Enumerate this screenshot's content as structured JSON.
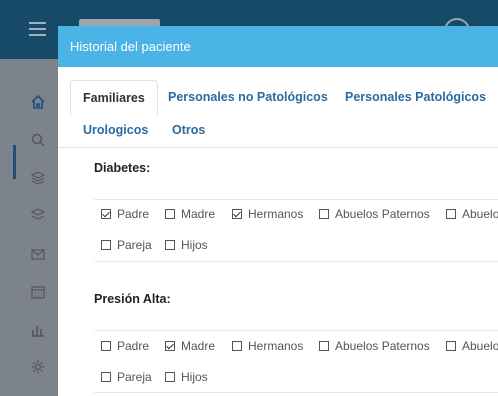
{
  "modal": {
    "title": "Historial del paciente"
  },
  "tabs": [
    {
      "label": "Familiares",
      "active": true
    },
    {
      "label": "Personales no Patológicos"
    },
    {
      "label": "Personales Patológicos"
    },
    {
      "label": "Urologicos"
    },
    {
      "label": "Otros"
    }
  ],
  "sections": [
    {
      "title": "Diabetes:",
      "options": [
        {
          "label": "Padre",
          "checked": true
        },
        {
          "label": "Madre",
          "checked": false
        },
        {
          "label": "Hermanos",
          "checked": true
        },
        {
          "label": "Abuelos Paternos",
          "checked": false
        },
        {
          "label": "Abuelo",
          "checked": false
        },
        {
          "label": "Pareja",
          "checked": false
        },
        {
          "label": "Hijos",
          "checked": false
        }
      ]
    },
    {
      "title": "Presión Alta:",
      "options": [
        {
          "label": "Padre",
          "checked": false
        },
        {
          "label": "Madre",
          "checked": true
        },
        {
          "label": "Hermanos",
          "checked": false
        },
        {
          "label": "Abuelos Paternos",
          "checked": false
        },
        {
          "label": "Abuelo",
          "checked": false
        },
        {
          "label": "Pareja",
          "checked": false
        },
        {
          "label": "Hijos",
          "checked": false
        }
      ]
    }
  ],
  "sidebar_icons": [
    "home-icon",
    "search-icon",
    "layers-icon",
    "stack-icon",
    "mail-icon",
    "calendar-icon",
    "bar-chart-icon",
    "settings-icon"
  ]
}
